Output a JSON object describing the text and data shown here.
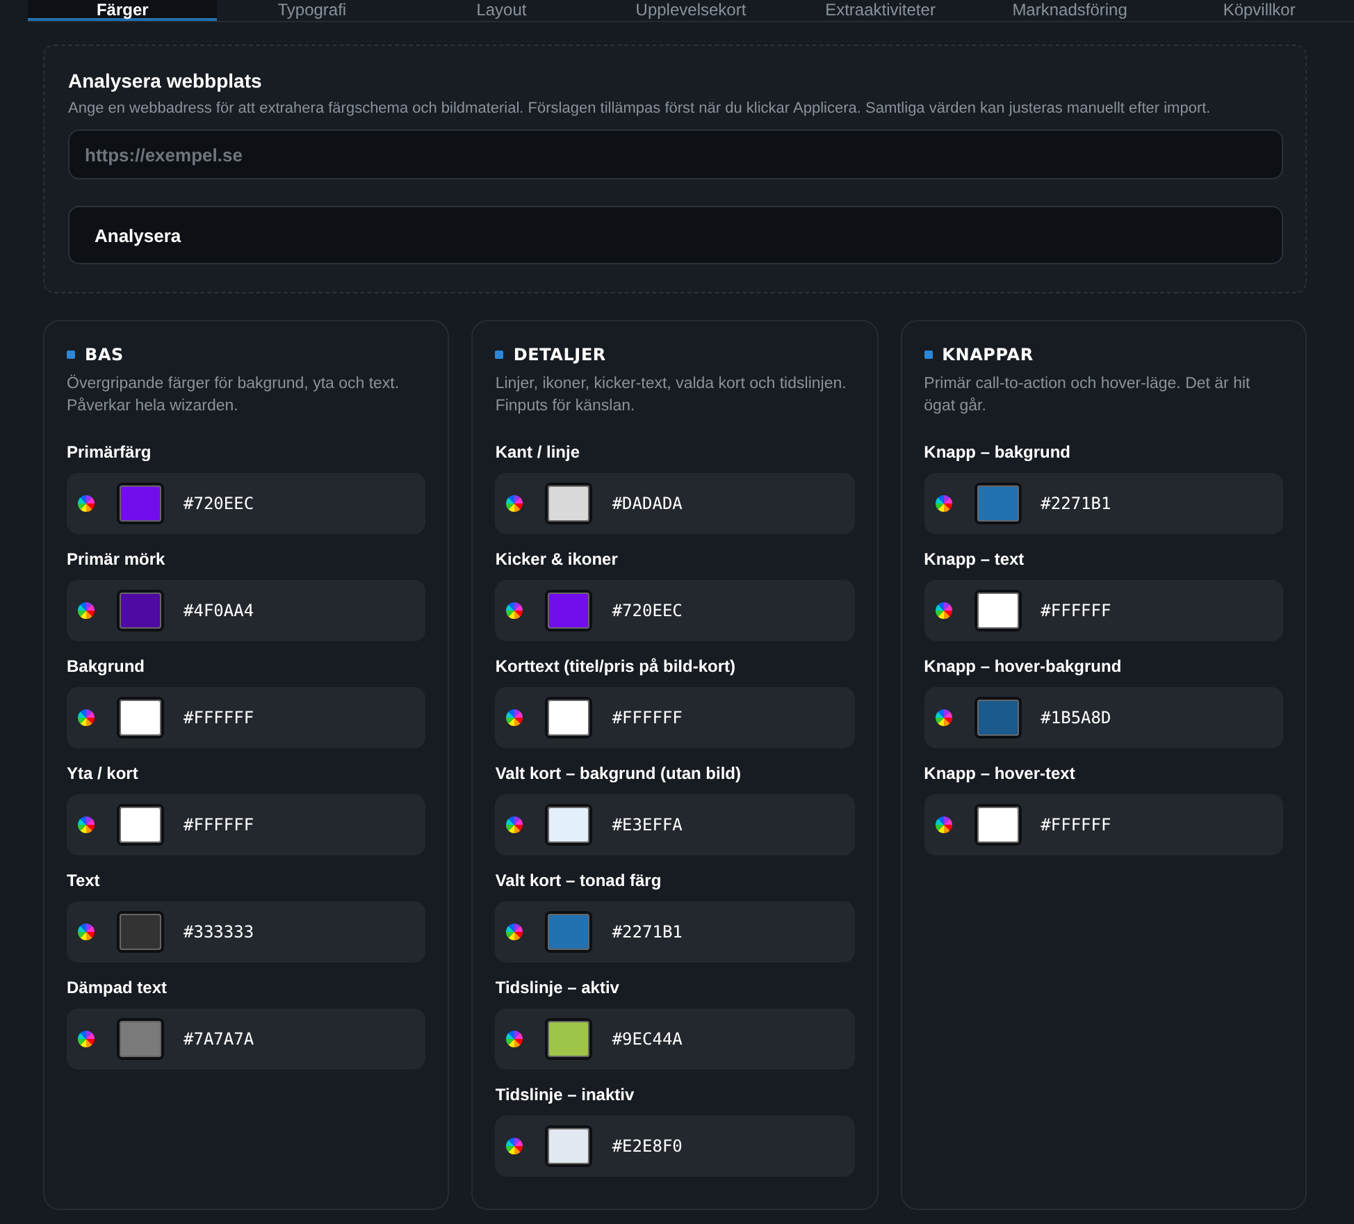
{
  "tabs": [
    {
      "label": "Färger",
      "selected": true
    },
    {
      "label": "Typografi",
      "selected": false
    },
    {
      "label": "Layout",
      "selected": false
    },
    {
      "label": "Upplevelsekort",
      "selected": false
    },
    {
      "label": "Extraaktiviteter",
      "selected": false
    },
    {
      "label": "Marknadsföring",
      "selected": false
    },
    {
      "label": "Köpvillkor",
      "selected": false
    }
  ],
  "analyze": {
    "title": "Analysera webbplats",
    "description": "Ange en webbadress för att extrahera färgschema och bildmaterial. Förslagen tillämpas först när du klickar Applicera. Samtliga värden kan justeras manuellt efter import.",
    "placeholder": "https://exempel.se",
    "button": "Analysera"
  },
  "groups": [
    {
      "title": "BAS",
      "description": "Övergripande färger för bakgrund, yta och text. Påverkar hela wizarden.",
      "fields": [
        {
          "label": "Primärfärg",
          "value": "#720EEC",
          "color": "#720eec"
        },
        {
          "label": "Primär mörk",
          "value": "#4F0AA4",
          "color": "#4f0aa4"
        },
        {
          "label": "Bakgrund",
          "value": "#FFFFFF",
          "color": "#ffffff"
        },
        {
          "label": "Yta / kort",
          "value": "#FFFFFF",
          "color": "#ffffff"
        },
        {
          "label": "Text",
          "value": "#333333",
          "color": "#333333"
        },
        {
          "label": "Dämpad text",
          "value": "#7A7A7A",
          "color": "#7a7a7a"
        }
      ]
    },
    {
      "title": "DETALJER",
      "description": "Linjer, ikoner, kicker-text, valda kort och tidslinjen. Finputs för känslan.",
      "fields": [
        {
          "label": "Kant / linje",
          "value": "#DADADA",
          "color": "#dadada"
        },
        {
          "label": "Kicker & ikoner",
          "value": "#720EEC",
          "color": "#720eec"
        },
        {
          "label": "Korttext (titel/pris på bild-kort)",
          "value": "#FFFFFF",
          "color": "#ffffff"
        },
        {
          "label": "Valt kort – bakgrund (utan bild)",
          "value": "#E3EFFA",
          "color": "#e3effa"
        },
        {
          "label": "Valt kort – tonad färg",
          "value": "#2271B1",
          "color": "#2271b1"
        },
        {
          "label": "Tidslinje – aktiv",
          "value": "#9EC44A",
          "color": "#9ec44a"
        },
        {
          "label": "Tidslinje – inaktiv",
          "value": "#E2E8F0",
          "color": "#e2e8f0"
        }
      ]
    },
    {
      "title": "KNAPPAR",
      "description": "Primär call-to-action och hover-läge. Det är hit ögat går.",
      "fields": [
        {
          "label": "Knapp – bakgrund",
          "value": "#2271B1",
          "color": "#2271b1"
        },
        {
          "label": "Knapp – text",
          "value": "#FFFFFF",
          "color": "#ffffff"
        },
        {
          "label": "Knapp – hover-bakgrund",
          "value": "#1B5A8D",
          "color": "#1b5a8d"
        },
        {
          "label": "Knapp – hover-text",
          "value": "#FFFFFF",
          "color": "#ffffff"
        }
      ]
    }
  ]
}
